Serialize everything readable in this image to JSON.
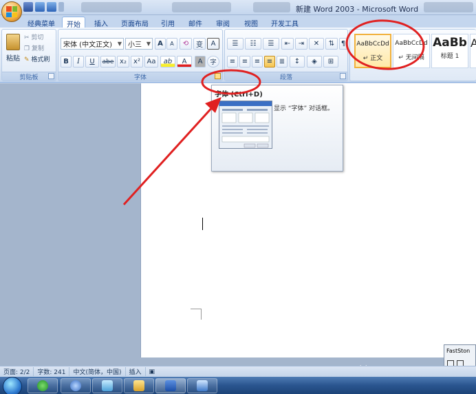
{
  "window": {
    "title": "新建 Word 2003 - Microsoft Word"
  },
  "tabs": [
    "经典菜单",
    "开始",
    "插入",
    "页面布局",
    "引用",
    "邮件",
    "审阅",
    "视图",
    "开发工具"
  ],
  "active_tab": "开始",
  "clipboard": {
    "paste_label": "粘贴",
    "cut_label": "剪切",
    "copy_label": "复制",
    "format_painter_label": "格式刷",
    "group_label": "剪贴板"
  },
  "font_group": {
    "font_name": "宋体 (中文正文)",
    "font_size": "小三",
    "grow_font": "A",
    "shrink_font": "A",
    "clear_format": "⟲",
    "phonetic": "变",
    "border_char": "A",
    "bold": "B",
    "italic": "I",
    "underline": "U",
    "strikethrough": "abe",
    "subscript": "x₂",
    "superscript": "x²",
    "change_case": "Aa",
    "highlight": "ab",
    "font_color": "A",
    "char_shading": "A",
    "enclose_char": "字",
    "group_label": "字体"
  },
  "paragraph_group": {
    "group_label": "段落"
  },
  "styles_group": {
    "tiles": [
      {
        "sample": "AaBbCcDd",
        "name": "↵ 正文"
      },
      {
        "sample": "AaBbCcDd",
        "name": "↵ 无间隔"
      },
      {
        "sample": "AaBb",
        "name": "标题 1"
      },
      {
        "sample": "A",
        "name": ""
      }
    ]
  },
  "tooltip": {
    "title": "字体 (Ctrl+D)",
    "description": "显示 “字体” 对话框。"
  },
  "status_bar": {
    "page": "页面: 2/2",
    "words": "字数: 241",
    "language": "中文(简体，中国)",
    "insert_mode": "插入"
  },
  "faststone": {
    "label": "FastSton"
  },
  "watermark": {
    "brand": "搜狗指南",
    "url": "zhinan.sogou.com"
  },
  "colors": {
    "annotation_red": "#e02020",
    "ribbon_bg": "#dbe6f4",
    "accent_blue": "#15428b"
  }
}
